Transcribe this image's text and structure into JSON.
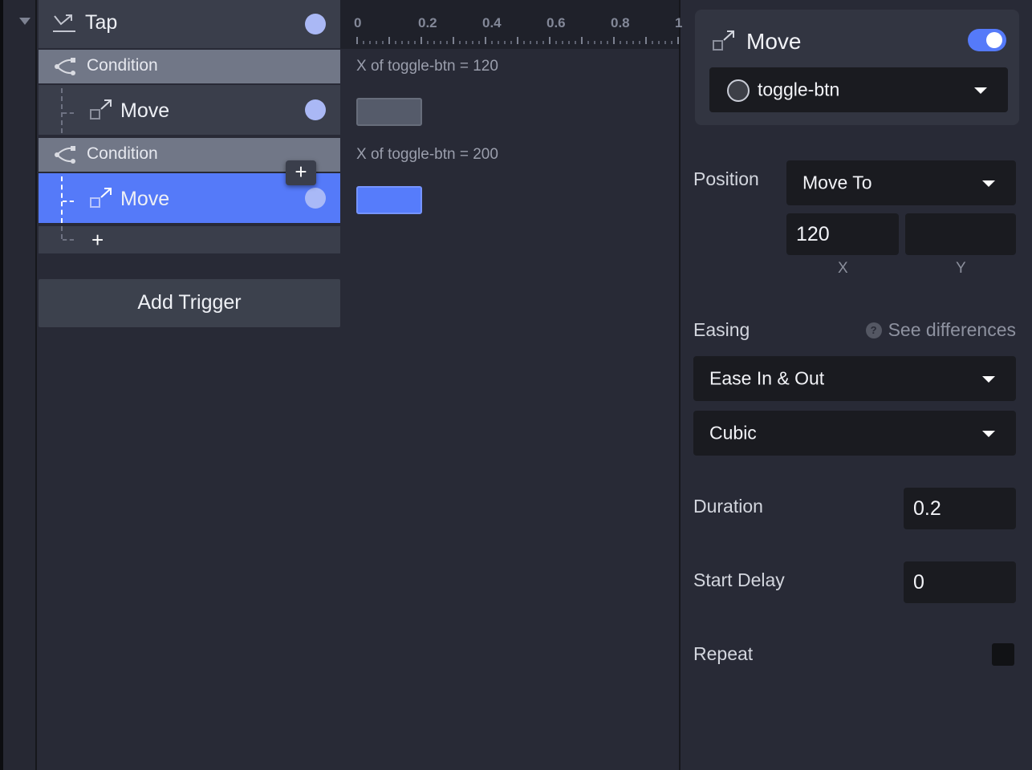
{
  "tree": {
    "trigger": {
      "label": "Tap",
      "icon": "tap-icon"
    },
    "items": [
      {
        "type": "condition",
        "label": "Condition",
        "icon": "condition-icon"
      },
      {
        "type": "action",
        "label": "Move",
        "icon": "move-icon",
        "selected": false
      },
      {
        "type": "condition",
        "label": "Condition",
        "icon": "condition-icon"
      },
      {
        "type": "action",
        "label": "Move",
        "icon": "move-icon",
        "selected": true
      }
    ],
    "add_action_glyph": "+",
    "insert_glyph": "+",
    "add_trigger_label": "Add Trigger"
  },
  "timeline": {
    "ruler_labels": [
      "0",
      "0.2",
      "0.4",
      "0.6",
      "0.8",
      "1"
    ],
    "ruler_range": [
      0,
      1
    ],
    "conditions": [
      {
        "label": "X of toggle-btn = 120",
        "state": "inactive",
        "start": 0,
        "duration": 0.2
      },
      {
        "label": "X of toggle-btn = 200",
        "state": "active",
        "start": 0,
        "duration": 0.2
      }
    ]
  },
  "inspector": {
    "title": "Move",
    "enabled": true,
    "target": "toggle-btn",
    "position": {
      "label": "Position",
      "mode": "Move To",
      "x": "120",
      "y": "",
      "x_label": "X",
      "y_label": "Y"
    },
    "easing": {
      "label": "Easing",
      "help_glyph": "?",
      "help_link": "See differences",
      "type": "Ease In & Out",
      "curve": "Cubic"
    },
    "duration": {
      "label": "Duration",
      "value": "0.2"
    },
    "start_delay": {
      "label": "Start Delay",
      "value": "0"
    },
    "repeat": {
      "label": "Repeat",
      "checked": false
    }
  },
  "colors": {
    "accent": "#557af9",
    "background": "#282a36",
    "row": "#3a3e4b",
    "condition_row": "#717787",
    "field": "#1a1b20"
  }
}
